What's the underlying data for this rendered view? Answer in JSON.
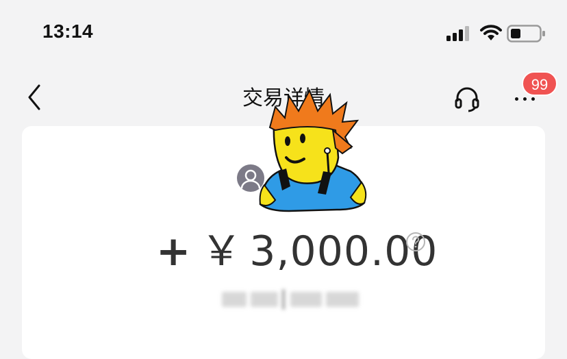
{
  "status_bar": {
    "time": "13:14"
  },
  "nav": {
    "title": "交易详情",
    "badge_count": "99",
    "icons": {
      "back": "chevron-left-icon",
      "support": "headset-icon",
      "more": "more-dots-icon"
    }
  },
  "transaction": {
    "sign": "+",
    "currency": "￥",
    "amount": "3,000.00"
  },
  "colors": {
    "background": "#f3f3f4",
    "card": "#ffffff",
    "badge": "#f05352",
    "amount_text": "#333333",
    "sticker_hair": "#f07a1c",
    "sticker_face": "#f6e21b",
    "sticker_shirt": "#2f9be6"
  }
}
